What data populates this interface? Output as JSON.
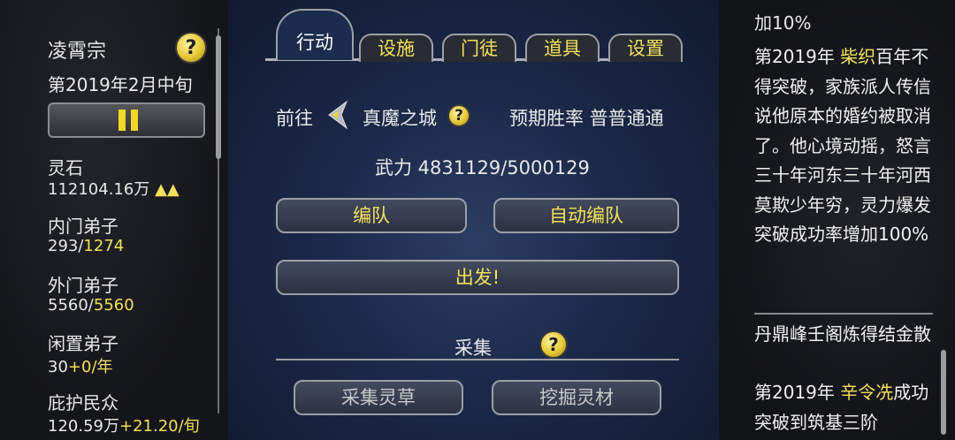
{
  "sidebar": {
    "sect_name": "凌霄宗",
    "date": "第2019年2月中旬",
    "help_label": "?",
    "stats": [
      {
        "label": "灵石",
        "value": "112104.16万",
        "extra": "▲▲"
      },
      {
        "label": "内门弟子",
        "value": "293/",
        "extra": "1274"
      },
      {
        "label": "外门弟子",
        "value": "5560/",
        "extra": "5560"
      },
      {
        "label": "闲置弟子",
        "value": "30",
        "extra": "+0/年"
      },
      {
        "label": "庇护民众",
        "value": "120.59万",
        "extra": "+21.20/旬"
      }
    ]
  },
  "tabs": [
    {
      "label": "行动",
      "active": true
    },
    {
      "label": "设施",
      "active": false
    },
    {
      "label": "门徒",
      "active": false
    },
    {
      "label": "道具",
      "active": false
    },
    {
      "label": "设置",
      "active": false
    }
  ],
  "action": {
    "goto_label": "前往",
    "destination": "真魔之城",
    "help_label": "?",
    "win_rate_label": "预期胜率 普普通通",
    "power_label": "武力 4831129/5000129",
    "team_button": "编队",
    "auto_team_button": "自动编队",
    "depart_button": "出发!"
  },
  "gather": {
    "title": "采集",
    "help_label": "?",
    "herb_button": "采集灵草",
    "ore_button": "挖掘灵材"
  },
  "log": {
    "entry1_tail": "加10%",
    "entry2": {
      "prefix": "第2019年 ",
      "name": "柴织",
      "text": "百年不得突破，家族派人传信说他原本的婚约被取消了。他心境动摇，怒言三十年河东三十年河西莫欺少年穷，灵力爆发突破成功率增加100%"
    },
    "entry3": "丹鼎峰壬阁炼得结金散",
    "entry4": {
      "prefix": "第2019年 ",
      "name": "辛令冼",
      "text": "成功突破到筑基三阶"
    }
  },
  "colors": {
    "accent": "#f2e05a",
    "panel_blue": "#1b2848"
  }
}
